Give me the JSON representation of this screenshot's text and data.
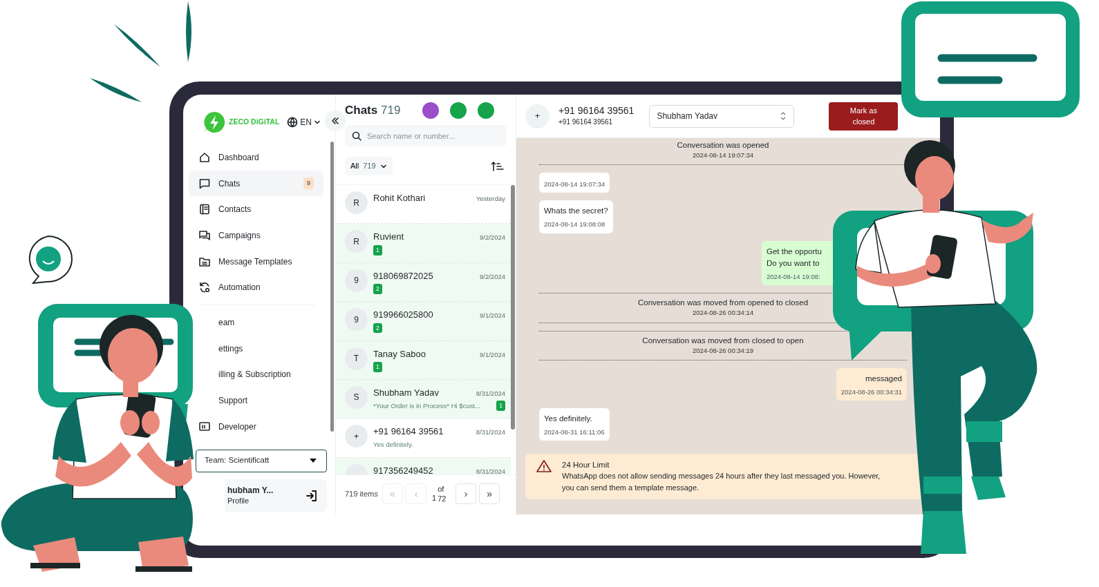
{
  "brand": {
    "name": "ZECO DiGiTAL"
  },
  "language": {
    "code": "EN"
  },
  "sidebar": {
    "groups": [
      {
        "items": [
          {
            "label": "Dashboard",
            "selected": false
          },
          {
            "label": "Chats",
            "badge": "9",
            "selected": true
          },
          {
            "label": "Contacts",
            "selected": false
          },
          {
            "label": "Campaigns",
            "selected": false
          },
          {
            "label": "Message Templates",
            "selected": false
          },
          {
            "label": "Automation",
            "selected": false
          }
        ]
      },
      {
        "items": [
          {
            "label": "eam",
            "selected": false
          },
          {
            "label": "ettings",
            "selected": false
          },
          {
            "label": "illing & Subscription",
            "selected": false
          },
          {
            "label": "Support",
            "selected": false
          },
          {
            "label": "Developer",
            "selected": false
          }
        ]
      }
    ],
    "team_select": {
      "value": "Team: Scientificatt"
    },
    "profile": {
      "name": "hubham Y...",
      "subtitle": "Profile"
    }
  },
  "chat_list": {
    "title": "Chats",
    "count": "719",
    "status_dots": [
      {
        "color": "#9b4dca"
      },
      {
        "color": "#16a34a"
      },
      {
        "color": "#16a34a"
      }
    ],
    "search": {
      "placeholder": "Search name or number..."
    },
    "filter": {
      "label": "All",
      "count": "719"
    },
    "chats": [
      {
        "avatar": "R",
        "name": "Rohit Kothari",
        "time": "Yesterday",
        "unread": false
      },
      {
        "avatar": "R",
        "name": "Ruvient",
        "time": "9/2/2024",
        "badge": "1",
        "unread": true
      },
      {
        "avatar": "9",
        "name": "918069872025",
        "time": "9/2/2024",
        "badge": "2",
        "unread": true
      },
      {
        "avatar": "9",
        "name": "919966025800",
        "time": "9/1/2024",
        "badge": "2",
        "unread": true
      },
      {
        "avatar": "T",
        "name": "Tanay Saboo",
        "time": "9/1/2024",
        "badge": "1",
        "unread": true
      },
      {
        "avatar": "S",
        "name": "Shubham Yadav",
        "time": "8/31/2024",
        "preview": "*Your Order is in Process* Hi $cust...",
        "badge": "1",
        "unread": true
      },
      {
        "avatar": "+",
        "name": "+91 96164 39561",
        "time": "8/31/2024",
        "preview": "Yes definitely.",
        "unread": false
      },
      {
        "name": "917356249452",
        "time": "8/31/2024",
        "unread": true
      }
    ],
    "pager": {
      "total": "719 items",
      "page": "1",
      "of": "of 72",
      "buttons": [
        {
          "glyph": "«",
          "disabled": true
        },
        {
          "glyph": "‹",
          "disabled": true
        },
        {
          "glyph": "›",
          "disabled": false
        },
        {
          "glyph": "»",
          "disabled": false
        }
      ]
    }
  },
  "chat": {
    "contact": {
      "avatar": "+",
      "name": "+91 96164 39561",
      "phone": "+91 96164 39561"
    },
    "assignee": {
      "value": "Shubham Yadav"
    },
    "close_button": {
      "label": "Mark as closed"
    },
    "messages": [
      {
        "kind": "event",
        "text": "Conversation was opened",
        "time": "2024-08-14 19:07:34"
      },
      {
        "kind": "incoming",
        "time": "2024-08-14 19:07:34"
      },
      {
        "kind": "incoming",
        "lines": [
          "Whats the secret?"
        ],
        "time": "2024-08-14 19:08:08"
      },
      {
        "kind": "outgoing",
        "color": "#d9fdd3",
        "lines": [
          "Get the opportu",
          "Do you want to"
        ],
        "time": "2024-08-14 19:08:"
      },
      {
        "kind": "event",
        "text": "Conversation was moved from opened to closed",
        "time": "2024-08-26 00:34:14"
      },
      {
        "kind": "event",
        "text": "Conversation was moved from closed to open",
        "time": "2024-08-26 00:34:19"
      },
      {
        "kind": "outgoing",
        "color": "#fdebd3",
        "lines": [
          "messaged"
        ],
        "time": "2024-08-26 00:34:31"
      },
      {
        "kind": "incoming",
        "lines": [
          "Yes definitely."
        ],
        "time": "2024-08-31 16:11:06"
      }
    ],
    "alert": {
      "title": "24 Hour Limit",
      "lines": [
        "WhatsApp does not allow sending messages 24 hours after they last messaged you. However,",
        "you can send them a template message."
      ]
    }
  }
}
